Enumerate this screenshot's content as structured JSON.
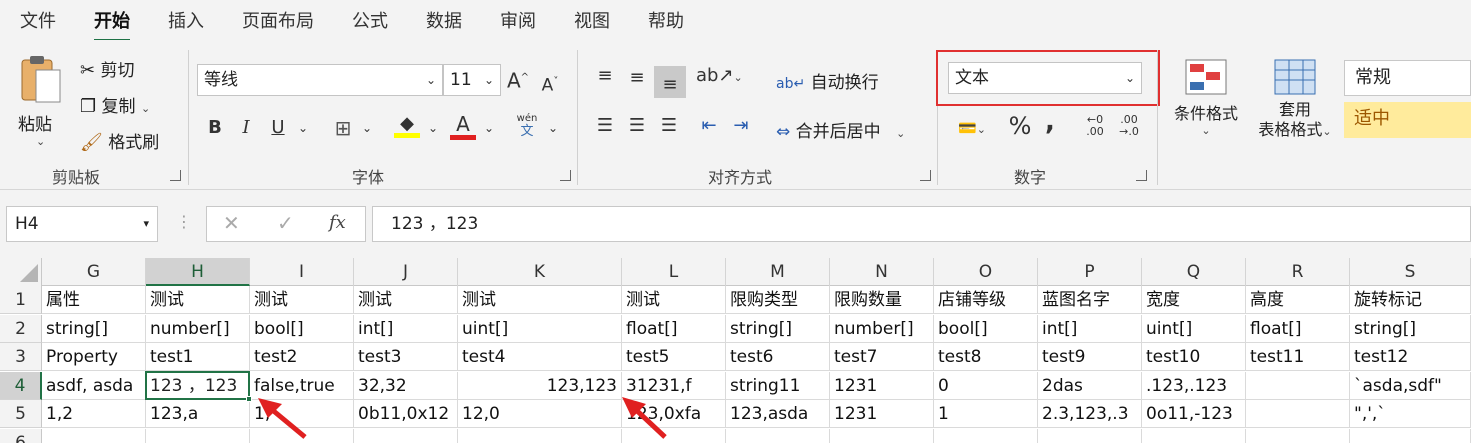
{
  "menu": {
    "tabs": [
      "文件",
      "开始",
      "插入",
      "页面布局",
      "公式",
      "数据",
      "审阅",
      "视图",
      "帮助"
    ]
  },
  "clipboard": {
    "paste": "粘贴",
    "cut": "剪切",
    "copy": "复制",
    "format_painter": "格式刷",
    "group": "剪贴板"
  },
  "font": {
    "name": "等线",
    "size": "11",
    "grow": "A^",
    "shrink": "A˅",
    "bold": "B",
    "italic": "I",
    "underline": "U",
    "phonetic_top": "wén",
    "phonetic_bottom": "文",
    "group": "字体"
  },
  "alignment": {
    "wrap": "自动换行",
    "merge": "合并后居中",
    "group": "对齐方式"
  },
  "number": {
    "format": "文本",
    "percent": "%",
    "comma": ",",
    "group": "数字"
  },
  "styles": {
    "conditional": "条件格式",
    "table_line1": "套用",
    "table_line2": "表格格式",
    "normal": "常规",
    "neutral": "适中"
  },
  "formula_bar": {
    "name_box": "H4",
    "fx": "fx",
    "content": "123 ，123"
  },
  "columns": [
    "G",
    "H",
    "I",
    "J",
    "K",
    "L",
    "M",
    "N",
    "O",
    "P",
    "Q",
    "R",
    "S"
  ],
  "rows": [
    "1",
    "2",
    "3",
    "4",
    "5",
    "6"
  ],
  "cells": [
    [
      "属性",
      "测试",
      "测试",
      "测试",
      "测试",
      "测试",
      "限购类型",
      "限购数量",
      "店铺等级",
      "蓝图名字",
      "宽度",
      "高度",
      "旋转标记"
    ],
    [
      "string[]",
      "number[]",
      "bool[]",
      "int[]",
      "uint[]",
      "float[]",
      "string[]",
      "number[]",
      "bool[]",
      "int[]",
      "uint[]",
      "float[]",
      "string[]"
    ],
    [
      "Property",
      "test1",
      "test2",
      "test3",
      "test4",
      "test5",
      "test6",
      "test7",
      "test8",
      "test9",
      "test10",
      "test11",
      "test12"
    ],
    [
      "asdf,   asda",
      "123  ，123",
      "false,true",
      "32,32",
      "123,123",
      "31231,f",
      "string11",
      "1231",
      "0",
      "2das",
      ".123,.123",
      "",
      "`asda,sdf\""
    ],
    [
      "1,2",
      "123,a",
      "1,",
      "0b11,0x12",
      "12,0",
      "123,0xfa",
      "123,asda",
      "1231",
      "1",
      "2.3,123,.3",
      "0o11,-123",
      "",
      "\",',`"
    ],
    [
      "",
      "",
      "",
      "",
      "",
      "",
      "",
      "",
      "",
      "",
      "",
      "",
      ""
    ]
  ],
  "colors": {
    "accent": "#217346",
    "highlight_box": "#e03030",
    "arrow": "#e02020",
    "neutral_bg": "#ffeb9c"
  }
}
